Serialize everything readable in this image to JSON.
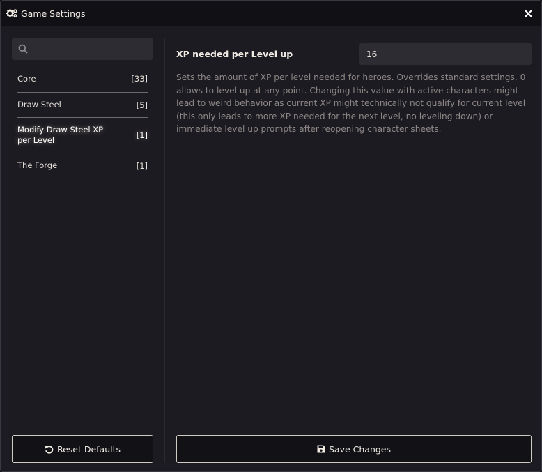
{
  "window": {
    "title": "Game Settings",
    "title_icon": "cogs-icon",
    "close_icon": "close-icon"
  },
  "sidebar": {
    "search": {
      "placeholder": "",
      "value": "",
      "icon": "search-icon"
    },
    "categories": [
      {
        "label": "Core",
        "count": "[33]",
        "active": false
      },
      {
        "label": "Draw Steel",
        "count": "[5]",
        "active": false
      },
      {
        "label": "Modify Draw Steel XP per Level",
        "count": "[1]",
        "active": true
      },
      {
        "label": "The Forge",
        "count": "[1]",
        "active": false
      }
    ]
  },
  "main": {
    "setting": {
      "label": "XP needed per Level up",
      "value": "16",
      "hint": "Sets the amount of XP per level needed for heroes. Overrides standard settings. 0 allows to level up at any point. Changing this value with active characters might lead to weird behavior as current XP might technically not qualify for current level (this only leads to more XP needed for the next level, no leveling down) or immediate level up prompts after reopening character sheets."
    }
  },
  "footer": {
    "reset_label": "Reset Defaults",
    "reset_icon": "undo-icon",
    "save_label": "Save Changes",
    "save_icon": "save-icon"
  },
  "colors": {
    "background": "#1c1b22",
    "titlebar": "#111015",
    "input_bg": "#2e2c33",
    "hint_text": "#8d8785",
    "button_border": "#cfcac2"
  }
}
